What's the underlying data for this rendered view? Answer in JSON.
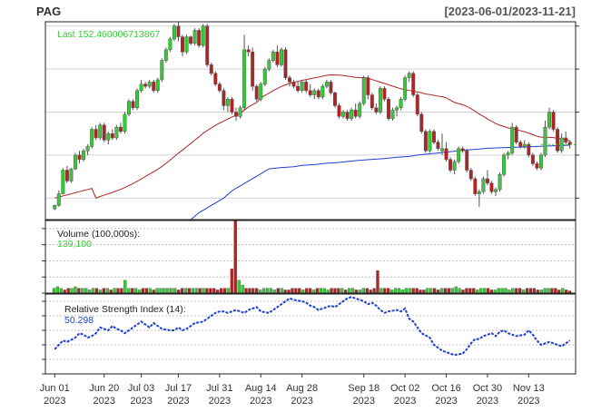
{
  "chart_data": [
    {
      "type": "candlestick",
      "title": "PAG",
      "date_range": "[2023-06-01/2023-11-21]",
      "last_label": "Last 152.460006713867",
      "y_ticks": [
        "140",
        "150",
        "160",
        "170",
        "180"
      ],
      "ylim": [
        135,
        181
      ],
      "up_color": "#32cd32",
      "down_color": "#b22222",
      "overlays": [
        {
          "name": "SMA 50",
          "color": "#b22222"
        },
        {
          "name": "SMA 200",
          "color": "#1f3fd0"
        }
      ],
      "candles": [
        [
          137.5,
          138.5,
          137.2,
          138.3
        ],
        [
          138.3,
          141.8,
          138.0,
          141.0
        ],
        [
          141.0,
          147.0,
          140.8,
          146.5
        ],
        [
          146.5,
          147.5,
          143.5,
          144.0
        ],
        [
          144.0,
          147.0,
          143.5,
          146.8
        ],
        [
          146.8,
          150.5,
          146.5,
          150.0
        ],
        [
          150.0,
          151.0,
          148.0,
          149.0
        ],
        [
          149.0,
          151.5,
          148.5,
          151.0
        ],
        [
          151.0,
          152.5,
          150.0,
          152.0
        ],
        [
          152.0,
          156.5,
          151.5,
          156.0
        ],
        [
          156.0,
          157.0,
          153.5,
          154.0
        ],
        [
          154.0,
          157.5,
          153.5,
          157.0
        ],
        [
          157.0,
          157.5,
          153.0,
          153.5
        ],
        [
          153.5,
          155.5,
          152.5,
          155.0
        ],
        [
          155.0,
          156.0,
          153.5,
          154.0
        ],
        [
          154.0,
          157.0,
          153.5,
          156.5
        ],
        [
          156.5,
          157.5,
          155.0,
          155.5
        ],
        [
          155.5,
          160.0,
          155.0,
          159.5
        ],
        [
          159.5,
          163.0,
          159.0,
          162.5
        ],
        [
          162.5,
          163.0,
          160.5,
          161.0
        ],
        [
          161.0,
          165.5,
          160.5,
          165.0
        ],
        [
          165.0,
          167.5,
          164.5,
          166.5
        ],
        [
          166.5,
          167.0,
          165.5,
          166.0
        ],
        [
          166.0,
          167.5,
          165.5,
          167.0
        ],
        [
          167.0,
          167.5,
          164.5,
          165.0
        ],
        [
          165.0,
          168.0,
          164.5,
          167.5
        ],
        [
          167.5,
          172.5,
          167.0,
          172.0
        ],
        [
          172.0,
          175.0,
          171.5,
          174.5
        ],
        [
          174.5,
          177.5,
          174.0,
          177.0
        ],
        [
          177.0,
          180.5,
          176.5,
          180.0
        ],
        [
          180.0,
          181.0,
          176.5,
          177.5
        ],
        [
          177.5,
          178.0,
          173.0,
          174.0
        ],
        [
          174.0,
          178.0,
          173.5,
          177.5
        ],
        [
          177.5,
          177.8,
          175.5,
          176.0
        ],
        [
          176.0,
          179.5,
          175.5,
          179.0
        ],
        [
          179.0,
          179.5,
          175.0,
          175.5
        ],
        [
          175.5,
          180.5,
          175.0,
          180.0
        ],
        [
          180.0,
          180.5,
          170.5,
          171.0
        ],
        [
          171.0,
          171.5,
          168.5,
          169.0
        ],
        [
          169.0,
          169.5,
          166.0,
          166.5
        ],
        [
          166.5,
          167.0,
          164.5,
          165.0
        ],
        [
          165.0,
          165.5,
          160.5,
          161.5
        ],
        [
          161.5,
          163.5,
          160.0,
          163.0
        ],
        [
          163.0,
          163.5,
          159.5,
          160.0
        ],
        [
          160.0,
          161.0,
          158.0,
          159.0
        ],
        [
          159.0,
          161.5,
          158.5,
          161.0
        ],
        [
          161.0,
          178.0,
          160.5,
          174.5
        ],
        [
          174.5,
          175.5,
          173.0,
          174.0
        ],
        [
          174.0,
          175.0,
          165.0,
          166.0
        ],
        [
          166.0,
          166.5,
          162.5,
          163.0
        ],
        [
          163.0,
          167.0,
          162.5,
          166.5
        ],
        [
          166.5,
          170.5,
          166.0,
          170.0
        ],
        [
          170.0,
          172.5,
          169.5,
          172.0
        ],
        [
          172.0,
          174.5,
          171.5,
          174.0
        ],
        [
          174.0,
          175.5,
          170.5,
          171.0
        ],
        [
          171.0,
          175.0,
          170.5,
          174.5
        ],
        [
          174.5,
          175.0,
          167.5,
          168.0
        ],
        [
          168.0,
          168.5,
          166.0,
          167.0
        ],
        [
          167.0,
          167.5,
          165.5,
          166.0
        ],
        [
          166.0,
          167.0,
          164.5,
          165.0
        ],
        [
          165.0,
          167.5,
          164.5,
          167.0
        ],
        [
          167.0,
          167.5,
          164.5,
          165.0
        ],
        [
          165.0,
          166.5,
          163.5,
          164.0
        ],
        [
          164.0,
          165.5,
          163.0,
          165.0
        ],
        [
          165.0,
          165.5,
          163.0,
          163.5
        ],
        [
          163.5,
          166.5,
          163.0,
          166.0
        ],
        [
          166.0,
          167.5,
          165.5,
          167.0
        ],
        [
          167.0,
          167.5,
          164.0,
          164.5
        ],
        [
          164.5,
          164.8,
          161.0,
          161.5
        ],
        [
          161.5,
          162.0,
          158.5,
          159.0
        ],
        [
          159.0,
          160.5,
          158.5,
          160.0
        ],
        [
          160.0,
          160.5,
          158.0,
          158.5
        ],
        [
          158.5,
          161.0,
          158.0,
          160.5
        ],
        [
          160.5,
          162.0,
          158.5,
          159.0
        ],
        [
          159.0,
          162.5,
          158.5,
          162.0
        ],
        [
          162.0,
          168.5,
          161.5,
          168.0
        ],
        [
          168.0,
          168.5,
          163.0,
          164.0
        ],
        [
          164.0,
          164.5,
          160.5,
          161.0
        ],
        [
          161.0,
          162.0,
          159.5,
          160.0
        ],
        [
          160.0,
          166.0,
          159.5,
          165.5
        ],
        [
          165.5,
          166.0,
          162.5,
          163.0
        ],
        [
          163.0,
          163.5,
          158.0,
          158.5
        ],
        [
          158.5,
          161.0,
          158.0,
          160.5
        ],
        [
          160.5,
          161.5,
          159.0,
          161.0
        ],
        [
          161.0,
          163.5,
          160.5,
          163.0
        ],
        [
          163.0,
          168.5,
          162.5,
          168.0
        ],
        [
          168.0,
          169.5,
          167.0,
          169.0
        ],
        [
          169.0,
          169.5,
          163.5,
          164.0
        ],
        [
          164.0,
          164.5,
          159.0,
          159.5
        ],
        [
          159.5,
          160.0,
          155.0,
          155.5
        ],
        [
          155.5,
          156.0,
          150.5,
          151.0
        ],
        [
          151.0,
          156.0,
          150.5,
          155.5
        ],
        [
          155.5,
          156.0,
          152.5,
          153.0
        ],
        [
          153.0,
          153.5,
          151.0,
          151.5
        ],
        [
          151.0,
          155.0,
          150.0,
          151.5
        ],
        [
          151.5,
          153.0,
          148.5,
          149.0
        ],
        [
          149.0,
          149.5,
          146.0,
          146.5
        ],
        [
          146.5,
          149.0,
          145.5,
          148.5
        ],
        [
          148.5,
          152.0,
          148.0,
          151.5
        ],
        [
          151.5,
          152.0,
          150.5,
          151.0
        ],
        [
          151.0,
          151.5,
          146.0,
          146.5
        ],
        [
          146.5,
          147.0,
          144.0,
          144.5
        ],
        [
          144.5,
          145.0,
          140.5,
          141.0
        ],
        [
          141.0,
          142.0,
          138.0,
          141.5
        ],
        [
          141.5,
          145.0,
          141.0,
          144.5
        ],
        [
          144.5,
          146.5,
          143.0,
          143.5
        ],
        [
          143.5,
          144.0,
          141.0,
          141.5
        ],
        [
          141.5,
          142.5,
          140.5,
          142.0
        ],
        [
          142.0,
          146.0,
          141.5,
          145.5
        ],
        [
          145.5,
          150.5,
          145.0,
          150.0
        ],
        [
          150.0,
          151.0,
          149.0,
          150.5
        ],
        [
          150.5,
          157.5,
          150.0,
          156.5
        ],
        [
          156.5,
          157.0,
          152.5,
          153.0
        ],
        [
          153.0,
          153.5,
          151.5,
          152.0
        ],
        [
          152.0,
          153.5,
          151.5,
          152.5
        ],
        [
          152.5,
          153.0,
          149.5,
          150.0
        ],
        [
          150.0,
          150.5,
          147.5,
          148.0
        ],
        [
          148.0,
          148.5,
          146.5,
          147.0
        ],
        [
          147.0,
          150.5,
          146.5,
          150.0
        ],
        [
          150.0,
          158.0,
          149.5,
          156.5
        ],
        [
          156.5,
          161.0,
          156.0,
          160.0
        ],
        [
          160.0,
          160.5,
          155.5,
          156.0
        ],
        [
          156.0,
          156.5,
          150.5,
          151.0
        ],
        [
          151.0,
          155.0,
          150.5,
          154.0
        ],
        [
          154.0,
          155.5,
          152.5,
          153.0
        ],
        [
          153.0,
          153.5,
          151.5,
          152.46
        ]
      ],
      "sma_long": [
        145.0,
        145.3,
        145.6,
        145.9,
        146.2,
        146.5,
        146.8,
        147.1,
        147.3,
        147.6,
        147.8,
        148.1,
        148.3,
        148.6,
        148.8,
        149.0,
        149.2,
        149.5,
        149.7,
        150.0,
        150.3,
        150.6,
        150.9,
        151.2,
        151.4,
        151.6,
        151.7,
        151.8,
        151.9,
        152.0,
        152.1,
        152.2,
        152.3
      ],
      "volume": {
        "label": "Volume (100,000s):",
        "last": "139,100",
        "ylim": [
          0,
          45
        ],
        "y_ticks": [
          "0",
          "10",
          "20",
          "30",
          "40"
        ],
        "values": [
          3,
          4,
          3,
          2,
          3,
          3,
          4,
          3,
          3,
          3,
          2,
          3,
          3,
          2,
          3,
          3,
          2,
          3,
          3,
          3,
          8,
          3,
          3,
          3,
          2,
          3,
          3,
          3,
          2,
          3,
          3,
          3,
          3,
          3,
          3,
          2,
          3,
          3,
          3,
          3,
          3,
          3,
          3,
          3,
          3,
          3,
          2,
          3,
          3,
          3,
          15,
          45,
          8,
          5,
          3,
          3,
          3,
          3,
          2,
          3,
          3,
          3,
          2,
          3,
          3,
          2,
          2,
          3,
          3,
          3,
          2,
          3,
          3,
          2,
          3,
          3,
          3,
          2,
          3,
          3,
          3,
          3,
          2,
          3,
          3,
          2,
          2,
          3,
          3,
          2,
          3,
          14,
          3,
          3,
          3,
          2,
          3,
          3,
          2,
          3,
          3,
          3,
          3,
          2,
          2,
          3,
          3,
          3,
          2,
          3,
          3,
          3,
          3,
          4,
          3,
          2,
          3,
          3,
          3,
          2,
          3,
          3,
          3,
          2,
          2,
          3,
          3,
          3,
          2,
          3,
          3,
          3,
          2,
          3,
          3,
          3,
          2,
          2,
          3,
          3,
          3,
          3,
          2,
          3,
          2,
          1.4
        ]
      },
      "rsi": {
        "label": "Relative Strength Index (14):",
        "last": "50.298",
        "ylim": [
          30,
          85
        ],
        "y_ticks": [
          "30",
          "40",
          "50",
          "60",
          "70",
          "80"
        ],
        "color": "#1f3fd0",
        "values": [
          47,
          50,
          53,
          52,
          55,
          58,
          57,
          55,
          56,
          58,
          62,
          60,
          63,
          61,
          60,
          58,
          60,
          62,
          66,
          64,
          62,
          65,
          63,
          61,
          60,
          60,
          62,
          60,
          61,
          63,
          65,
          66,
          68,
          70,
          72,
          73,
          73,
          72,
          74,
          73,
          72,
          74,
          75,
          76,
          73,
          72,
          74,
          76,
          78,
          80,
          82,
          81,
          80,
          79,
          77,
          76,
          74,
          75,
          77,
          76,
          78,
          80,
          82,
          83,
          82,
          80,
          78,
          79,
          77,
          74,
          72,
          73,
          74,
          73,
          75,
          68,
          66,
          62,
          58,
          55,
          50,
          48,
          46,
          45,
          44,
          43,
          44,
          47,
          51,
          54,
          54,
          56,
          58,
          56,
          59,
          60,
          58,
          57,
          56,
          57,
          60,
          57,
          53,
          50,
          51,
          52,
          50,
          49,
          51,
          53
        ]
      },
      "x_labels": [
        {
          "text": "Jun 01\n2023",
          "i": 0
        },
        {
          "text": "Jun 20\n2023",
          "i": 12
        },
        {
          "text": "Jul 03\n2023",
          "i": 21
        },
        {
          "text": "Jul 17\n2023",
          "i": 30
        },
        {
          "text": "Jul 31\n2023",
          "i": 40
        },
        {
          "text": "Aug 14\n2023",
          "i": 50
        },
        {
          "text": "Aug 28\n2023",
          "i": 60
        },
        {
          "text": "Sep 18\n2023",
          "i": 75
        },
        {
          "text": "Oct 02\n2023",
          "i": 85
        },
        {
          "text": "Oct 16\n2023",
          "i": 95
        },
        {
          "text": "Oct 30\n2023",
          "i": 105
        },
        {
          "text": "Nov 13\n2023",
          "i": 115
        }
      ]
    }
  ]
}
